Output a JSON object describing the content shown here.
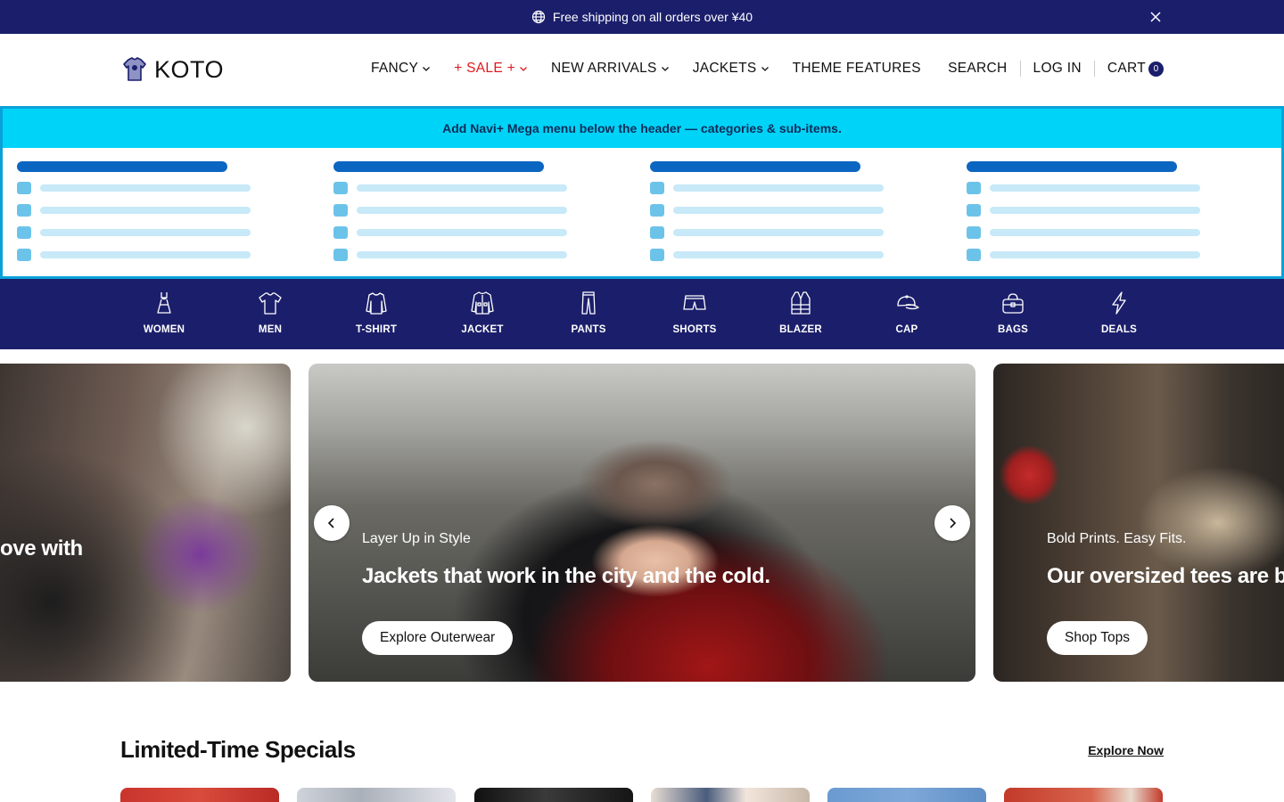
{
  "announcement": {
    "text": "Free shipping on all orders over ¥40"
  },
  "header": {
    "logo_text": "KOTO",
    "nav": [
      {
        "label": "FANCY",
        "has_dropdown": true,
        "highlight": false
      },
      {
        "label": "+ SALE +",
        "has_dropdown": true,
        "highlight": true
      },
      {
        "label": "NEW ARRIVALS",
        "has_dropdown": true,
        "highlight": false
      },
      {
        "label": "JACKETS",
        "has_dropdown": true,
        "highlight": false
      },
      {
        "label": "THEME FEATURES",
        "has_dropdown": false,
        "highlight": false
      }
    ],
    "search_label": "SEARCH",
    "login_label": "LOG IN",
    "cart_label": "CART",
    "cart_count": "0"
  },
  "mega_menu": {
    "banner_text": "Add Navi+ Mega menu below the header — categories & sub-items.",
    "columns": 4,
    "rows_per_column": 4
  },
  "categories": [
    {
      "label": "WOMEN",
      "icon": "dress-icon"
    },
    {
      "label": "MEN",
      "icon": "shirt-icon"
    },
    {
      "label": "T-SHIRT",
      "icon": "longsleeve-icon"
    },
    {
      "label": "JACKET",
      "icon": "jacket-icon"
    },
    {
      "label": "PANTS",
      "icon": "pants-icon"
    },
    {
      "label": "SHORTS",
      "icon": "shorts-icon"
    },
    {
      "label": "BLAZER",
      "icon": "vest-icon"
    },
    {
      "label": "CAP",
      "icon": "cap-icon"
    },
    {
      "label": "BAGS",
      "icon": "bag-icon"
    },
    {
      "label": "DEALS",
      "icon": "lightning-icon"
    }
  ],
  "hero": {
    "left_partial": {
      "headline": "ove with"
    },
    "center": {
      "eyebrow": "Layer Up in Style",
      "headline": "Jackets that work in the city and the cold.",
      "cta": "Explore Outerwear"
    },
    "right": {
      "eyebrow": "Bold Prints. Easy Fits.",
      "headline": "Our oversized tees are bac",
      "cta": "Shop Tops"
    }
  },
  "specials": {
    "title": "Limited-Time Specials",
    "link": "Explore Now"
  },
  "colors": {
    "navy": "#1b1f6b",
    "sale_red": "#e0181d",
    "mega_cyan": "#00d3f8",
    "mega_border": "#0aa1d8",
    "mega_head": "#0b66c2"
  }
}
